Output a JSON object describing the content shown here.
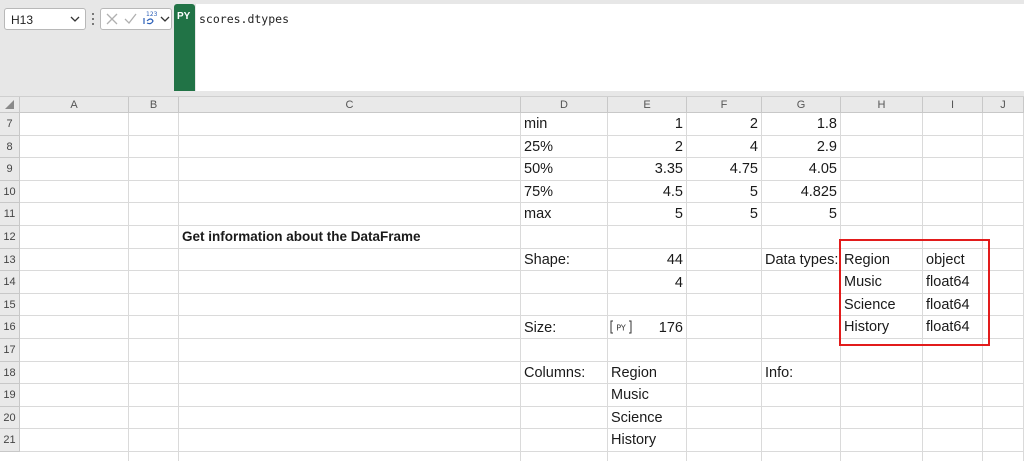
{
  "name_box": {
    "value": "H13"
  },
  "formula_bar": {
    "badge": "PY",
    "formula": "scores.dtypes"
  },
  "columns": [
    "A",
    "B",
    "C",
    "D",
    "E",
    "F",
    "G",
    "H",
    "I",
    "J"
  ],
  "rows": [
    "7",
    "8",
    "9",
    "10",
    "11",
    "12",
    "13",
    "14",
    "15",
    "16",
    "17",
    "18",
    "19",
    "20",
    "21"
  ],
  "describe_stats": [
    {
      "label": "min",
      "e": "1",
      "f": "2",
      "g": "1.8"
    },
    {
      "label": "25%",
      "e": "2",
      "f": "4",
      "g": "2.9"
    },
    {
      "label": "50%",
      "e": "3.35",
      "f": "4.75",
      "g": "4.05"
    },
    {
      "label": "75%",
      "e": "4.5",
      "f": "5",
      "g": "4.825"
    },
    {
      "label": "max",
      "e": "5",
      "f": "5",
      "g": "5"
    }
  ],
  "section_title": "Get information about the DataFrame",
  "shape": {
    "label": "Shape:",
    "rows": "44",
    "cols": "4"
  },
  "size": {
    "label": "Size:",
    "value": "176"
  },
  "columns_info": {
    "label": "Columns:",
    "names": [
      "Region",
      "Music",
      "Science",
      "History"
    ]
  },
  "dtypes": {
    "label": "Data types:",
    "items": [
      {
        "name": "Region",
        "type": "object"
      },
      {
        "name": "Music",
        "type": "float64"
      },
      {
        "name": "Science",
        "type": "float64"
      },
      {
        "name": "History",
        "type": "float64"
      }
    ]
  },
  "info": {
    "label": "Info:"
  },
  "colors": {
    "python_badge": "#217346",
    "highlight_border": "#e21b1b",
    "header_bg": "#e9e9e9"
  }
}
